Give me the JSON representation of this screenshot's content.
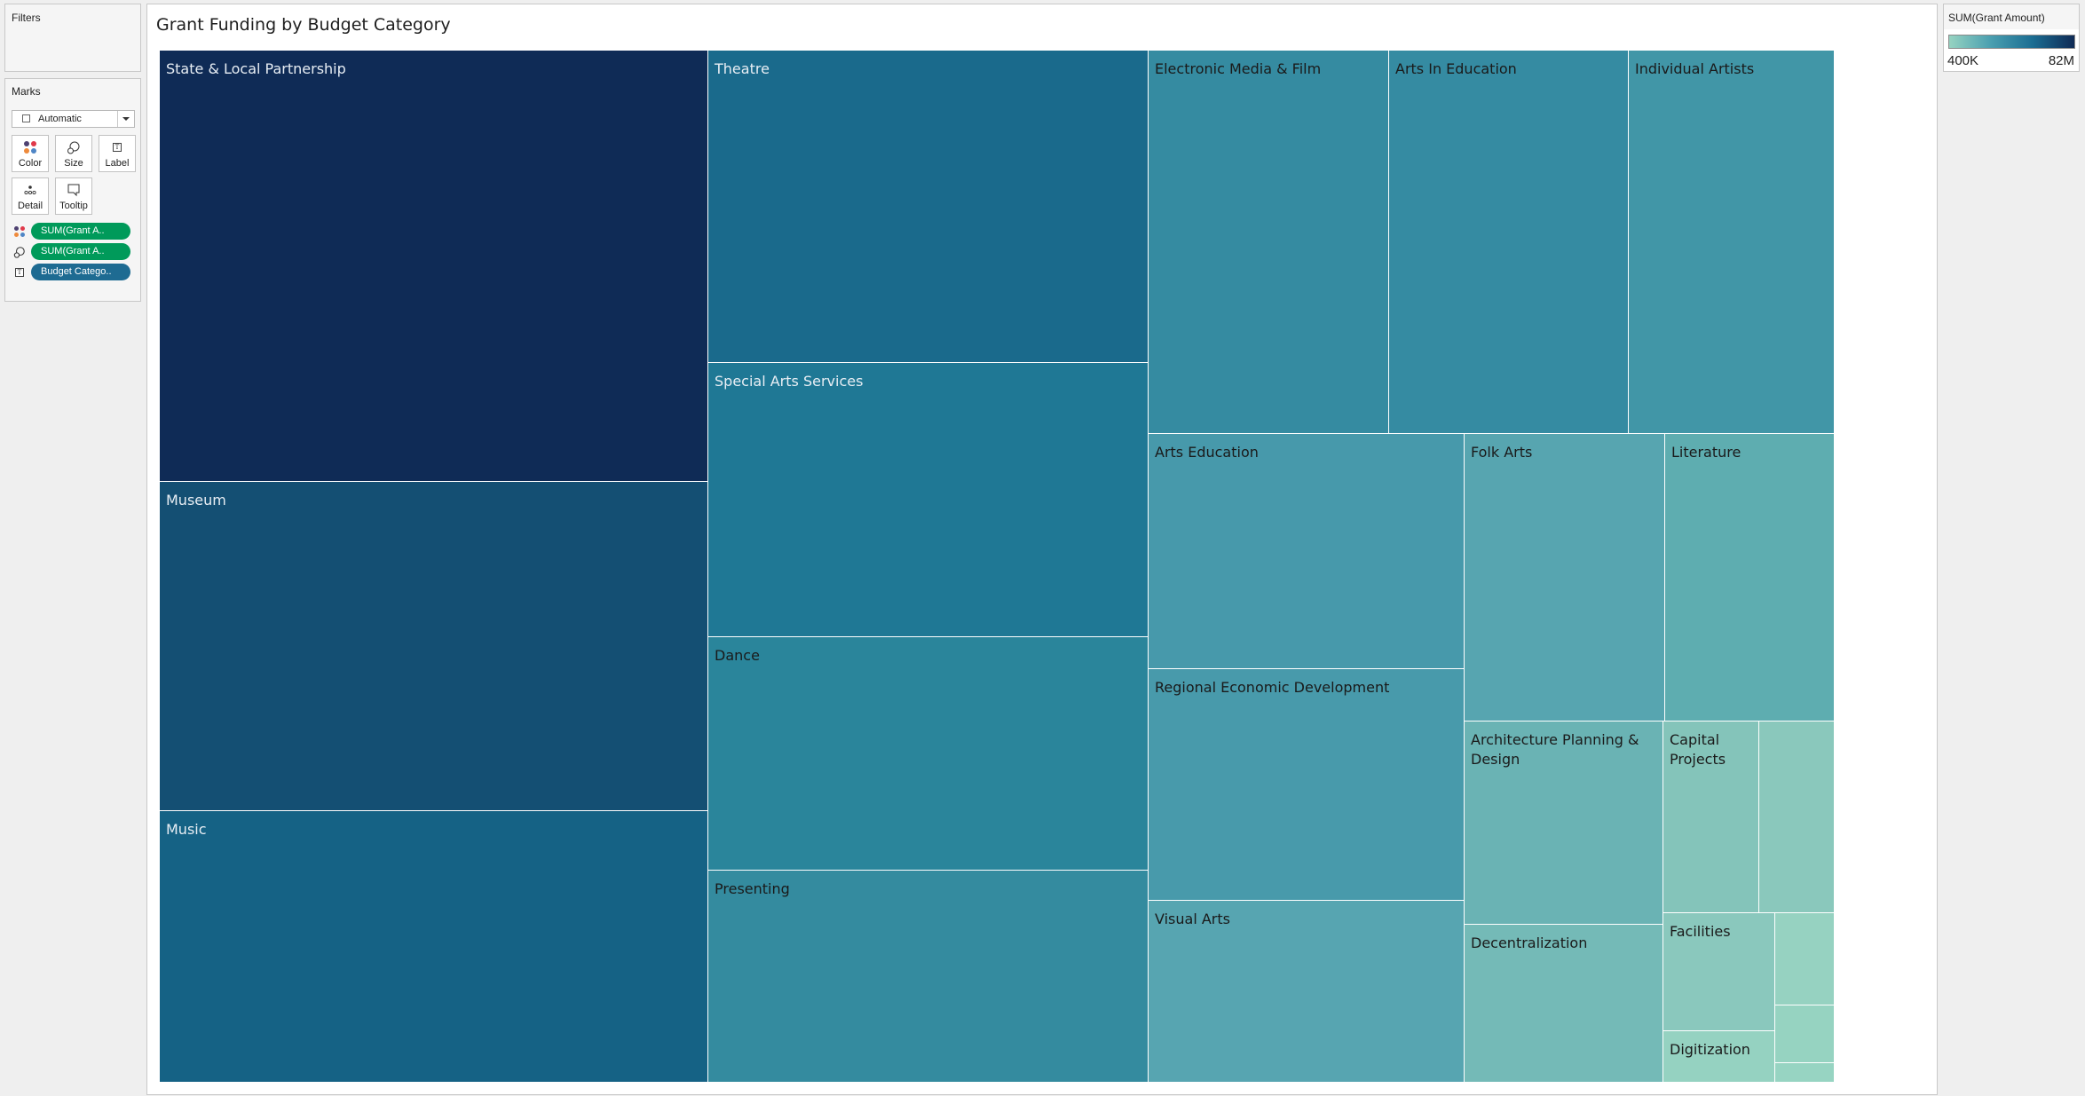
{
  "filters": {
    "title": "Filters"
  },
  "marks": {
    "title": "Marks",
    "mark_type": "Automatic",
    "buttons": [
      {
        "label": "Color",
        "icon": "color-dots-icon"
      },
      {
        "label": "Size",
        "icon": "size-circles-icon"
      },
      {
        "label": "Label",
        "icon": "label-text-icon"
      },
      {
        "label": "Detail",
        "icon": "detail-dots-icon"
      },
      {
        "label": "Tooltip",
        "icon": "tooltip-speech-icon"
      }
    ],
    "pills": [
      {
        "icon": "color-dots-icon",
        "label": "SUM(Grant A..",
        "color": "#009a5a"
      },
      {
        "icon": "size-circles-icon",
        "label": "SUM(Grant A..",
        "color": "#009a5a"
      },
      {
        "icon": "label-text-icon",
        "label": "Budget Catego..",
        "color": "#1e6b92"
      }
    ]
  },
  "legend": {
    "title": "SUM(Grant Amount)",
    "min_label": "400K",
    "max_label": "82M",
    "gradient": [
      "#96d3c1",
      "#4a9fb0",
      "#1b6d92",
      "#0f2a55"
    ]
  },
  "chart_data": {
    "type": "treemap",
    "title": "Grant Funding by Budget Category",
    "measure": "SUM(Grant Amount)",
    "color_range": [
      400000,
      82000000
    ],
    "nodes": [
      {
        "label": "State & Local Partnership",
        "value": 82000000,
        "color": "#0f2b56",
        "text_color": "#e8eef4"
      },
      {
        "label": "Museum",
        "value": 62800000,
        "color": "#144f73",
        "text_color": "#e8eef4"
      },
      {
        "label": "Music",
        "value": 51600000,
        "color": "#156285",
        "text_color": "#e8eef4"
      },
      {
        "label": "Theatre",
        "value": 47700000,
        "color": "#1a6a8c",
        "text_color": "#e8eef4"
      },
      {
        "label": "Special Arts Services",
        "value": 41800000,
        "color": "#1f7895",
        "text_color": "#e8eef4"
      },
      {
        "label": "Dance",
        "value": 35700000,
        "color": "#2a859b",
        "text_color": "#1a1a1a"
      },
      {
        "label": "Presenting",
        "value": 32300000,
        "color": "#348b9f",
        "text_color": "#1a1a1a"
      },
      {
        "label": "Electronic Media & Film",
        "value": 32000000,
        "color": "#358ba1",
        "text_color": "#1a1a1a"
      },
      {
        "label": "Arts In Education",
        "value": 31800000,
        "color": "#358ba2",
        "text_color": "#1a1a1a"
      },
      {
        "label": "Individual Artists",
        "value": 27400000,
        "color": "#4196a7",
        "text_color": "#1a1a1a"
      },
      {
        "label": "Arts Education",
        "value": 25700000,
        "color": "#4799ab",
        "text_color": "#1a1a1a"
      },
      {
        "label": "Regional Economic Development",
        "value": 25300000,
        "color": "#489aab",
        "text_color": "#1a1a1a"
      },
      {
        "label": "Folk Arts",
        "value": 20000000,
        "color": "#57a5b0",
        "text_color": "#1a1a1a"
      },
      {
        "label": "Visual Arts",
        "value": 19900000,
        "color": "#57a5b1",
        "text_color": "#1a1a1a"
      },
      {
        "label": "Literature",
        "value": 16900000,
        "color": "#5eadb0",
        "text_color": "#1a1a1a"
      },
      {
        "label": "Architecture Planning & Design",
        "value": 14000000,
        "color": "#6ab3b4",
        "text_color": "#1a1a1a"
      },
      {
        "label": "Decentralization",
        "value": 10900000,
        "color": "#74bab7",
        "text_color": "#1a1a1a"
      },
      {
        "label": "Capital Projects",
        "value": 6400000,
        "color": "#84c4ba",
        "text_color": "#1a1a1a"
      },
      {
        "label": "",
        "value": 5000000,
        "color": "#8ac8bc",
        "text_color": "#1a1a1a"
      },
      {
        "label": "Facilities",
        "value": 4600000,
        "color": "#8ac8bd",
        "text_color": "#1a1a1a"
      },
      {
        "label": "Digitization",
        "value": 2000000,
        "color": "#95d2c1",
        "text_color": "#1a1a1a"
      },
      {
        "label": "",
        "value": 1900000,
        "color": "#96d2c1",
        "text_color": "#1a1a1a"
      },
      {
        "label": "",
        "value": 1200000,
        "color": "#96d3c1",
        "text_color": "#1a1a1a"
      },
      {
        "label": "",
        "value": 400000,
        "color": "#97d4c2",
        "text_color": "#1a1a1a"
      }
    ]
  }
}
